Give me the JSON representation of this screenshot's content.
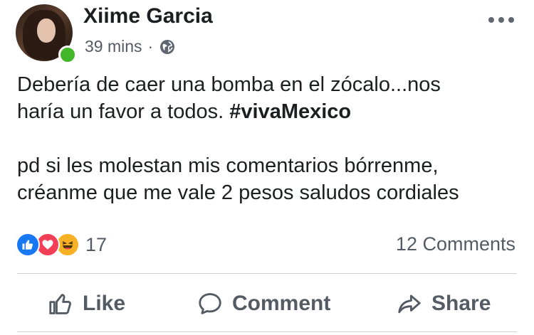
{
  "post": {
    "author": "Xiime Garcia",
    "time": "39 mins",
    "separator": "·",
    "audience_icon": "globe-icon",
    "more_icon": "more-options-icon",
    "text_line1": "Debería de caer una bomba en el zócalo...nos",
    "text_line2_pre": "haría un favor a todos. ",
    "hashtag": "#vivaMexico",
    "text_line3": "pd si les molestan mis comentarios bórrenme,",
    "text_line4": "créanme que me vale 2 pesos  saludos cordiales"
  },
  "stats": {
    "reactions": [
      "like-reaction-icon",
      "love-reaction-icon",
      "haha-reaction-icon"
    ],
    "reaction_count": "17",
    "comments": "12 Comments"
  },
  "actions": {
    "like": "Like",
    "comment": "Comment",
    "share": "Share"
  },
  "colors": {
    "brand_blue": "#1877f2",
    "love_red": "#f33e58",
    "haha_yellow": "#f7b125",
    "online_green": "#42b72a",
    "muted_text": "#555b65"
  }
}
